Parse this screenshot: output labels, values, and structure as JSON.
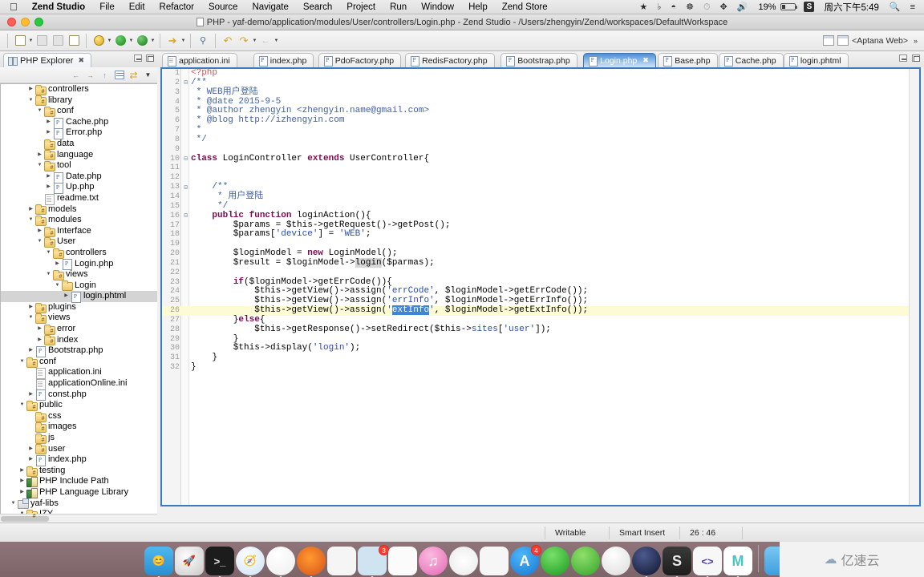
{
  "menubar": {
    "apple": "apple-logo",
    "items": [
      "Zend Studio",
      "File",
      "Edit",
      "Refactor",
      "Source",
      "Navigate",
      "Search",
      "Project",
      "Run",
      "Window",
      "Help",
      "Zend Store"
    ],
    "status_icons": [
      "dropbox-icon",
      "sound-icon",
      "wifi-icon",
      "accessibility-icon",
      "timemachine-icon",
      "bluetooth-icon",
      "volume-icon"
    ],
    "battery_percent": "19%",
    "input_method": "S",
    "clock": "周六下午5:49",
    "spotlight": "search-icon",
    "notification": "notification-center-icon"
  },
  "window": {
    "title": "PHP - yaf-demo/application/modules/User/controllers/Login.php - Zend Studio - /Users/zhengyin/Zend/workspaces/DefaultWorkspace"
  },
  "toolbar": {
    "perspective_label": "<Aptana Web>",
    "buttons": [
      "new-wizard",
      "save",
      "save-all",
      "print",
      "debug",
      "run",
      "run-coverage",
      "external-tools",
      "search",
      "undo",
      "redo",
      "back",
      "forward"
    ]
  },
  "left_panel": {
    "view_title": "PHP Explorer",
    "toolbar_buttons": [
      "back",
      "forward",
      "up",
      "collapse-all",
      "link-with-editor",
      "view-menu"
    ],
    "tree": [
      {
        "depth": 3,
        "twist": "closed",
        "icon": "folder pkg",
        "label": "controllers"
      },
      {
        "depth": 3,
        "twist": "open",
        "icon": "folder pkg",
        "label": "library"
      },
      {
        "depth": 4,
        "twist": "open",
        "icon": "folder pkg",
        "label": "conf"
      },
      {
        "depth": 5,
        "twist": "closed",
        "icon": "php",
        "label": "Cache.php"
      },
      {
        "depth": 5,
        "twist": "closed",
        "icon": "php",
        "label": "Error.php"
      },
      {
        "depth": 4,
        "twist": "none",
        "icon": "folder pkg",
        "label": "data"
      },
      {
        "depth": 4,
        "twist": "closed",
        "icon": "folder pkg",
        "label": "language"
      },
      {
        "depth": 4,
        "twist": "open",
        "icon": "folder pkg",
        "label": "tool"
      },
      {
        "depth": 5,
        "twist": "closed",
        "icon": "php",
        "label": "Date.php"
      },
      {
        "depth": 5,
        "twist": "closed",
        "icon": "php",
        "label": "Up.php"
      },
      {
        "depth": 4,
        "twist": "none",
        "icon": "txt",
        "label": "readme.txt"
      },
      {
        "depth": 3,
        "twist": "closed",
        "icon": "folder pkg",
        "label": "models"
      },
      {
        "depth": 3,
        "twist": "open",
        "icon": "folder pkg",
        "label": "modules"
      },
      {
        "depth": 4,
        "twist": "closed",
        "icon": "folder pkg",
        "label": "Interface"
      },
      {
        "depth": 4,
        "twist": "open",
        "icon": "folder pkg",
        "label": "User"
      },
      {
        "depth": 5,
        "twist": "open",
        "icon": "folder pkg",
        "label": "controllers"
      },
      {
        "depth": 6,
        "twist": "closed",
        "icon": "php",
        "label": "Login.php"
      },
      {
        "depth": 5,
        "twist": "open",
        "icon": "folder pkg",
        "label": "views"
      },
      {
        "depth": 6,
        "twist": "open",
        "icon": "folder",
        "label": "Login"
      },
      {
        "depth": 7,
        "twist": "closed",
        "icon": "php",
        "label": "login.phtml",
        "selected": true
      },
      {
        "depth": 3,
        "twist": "closed",
        "icon": "folder pkg",
        "label": "plugins"
      },
      {
        "depth": 3,
        "twist": "open",
        "icon": "folder pkg",
        "label": "views"
      },
      {
        "depth": 4,
        "twist": "closed",
        "icon": "folder pkg",
        "label": "error"
      },
      {
        "depth": 4,
        "twist": "closed",
        "icon": "folder pkg",
        "label": "index"
      },
      {
        "depth": 3,
        "twist": "closed",
        "icon": "php",
        "label": "Bootstrap.php"
      },
      {
        "depth": 2,
        "twist": "open",
        "icon": "folder pkg",
        "label": "conf"
      },
      {
        "depth": 3,
        "twist": "none",
        "icon": "txt",
        "label": "application.ini"
      },
      {
        "depth": 3,
        "twist": "none",
        "icon": "txt",
        "label": "applicationOnline.ini"
      },
      {
        "depth": 3,
        "twist": "closed",
        "icon": "php",
        "label": "const.php"
      },
      {
        "depth": 2,
        "twist": "open",
        "icon": "folder pkg",
        "label": "public"
      },
      {
        "depth": 3,
        "twist": "none",
        "icon": "folder pkg",
        "label": "css"
      },
      {
        "depth": 3,
        "twist": "none",
        "icon": "folder pkg",
        "label": "images"
      },
      {
        "depth": 3,
        "twist": "none",
        "icon": "folder pkg",
        "label": "js"
      },
      {
        "depth": 3,
        "twist": "closed",
        "icon": "folder pkg",
        "label": "user"
      },
      {
        "depth": 3,
        "twist": "closed",
        "icon": "php",
        "label": "index.php"
      },
      {
        "depth": 2,
        "twist": "closed",
        "icon": "folder pkg",
        "label": "testing"
      },
      {
        "depth": 2,
        "twist": "closed",
        "icon": "lib",
        "label": "PHP Include Path"
      },
      {
        "depth": 2,
        "twist": "closed",
        "icon": "lib",
        "label": "PHP Language Library"
      },
      {
        "depth": 1,
        "twist": "open",
        "icon": "proj",
        "label": "yaf-libs"
      },
      {
        "depth": 2,
        "twist": "open",
        "icon": "folder pkg",
        "label": "IZY"
      }
    ]
  },
  "editor": {
    "tabs": [
      {
        "label": "application.ini",
        "icon": "ini",
        "active": false
      },
      {
        "label": "index.php",
        "icon": "php",
        "active": false
      },
      {
        "label": "PdoFactory.php",
        "icon": "php",
        "active": false
      },
      {
        "label": "RedisFactory.php",
        "icon": "php",
        "active": false
      },
      {
        "label": "Bootstrap.php",
        "icon": "php",
        "active": false
      },
      {
        "label": "Login.php",
        "icon": "php",
        "active": true
      },
      {
        "label": "Base.php",
        "icon": "php",
        "active": false
      },
      {
        "label": "Cache.php",
        "icon": "php",
        "active": false
      },
      {
        "label": "login.phtml",
        "icon": "php",
        "active": false
      }
    ],
    "lines": [
      {
        "n": 1,
        "fold": "",
        "html": "<span class=\"phptag\">&lt;?php</span>"
      },
      {
        "n": 2,
        "fold": "-",
        "html": "<span class=\"cm\">/**</span>"
      },
      {
        "n": 3,
        "fold": "",
        "html": "<span class=\"cm\"> * WEB用户登陆</span>"
      },
      {
        "n": 4,
        "fold": "",
        "html": "<span class=\"cm\"> * @date 2015-9-5</span>"
      },
      {
        "n": 5,
        "fold": "",
        "html": "<span class=\"cm\"> * @author zhengyin &lt;zhengyin.name@gmail.com&gt;</span>"
      },
      {
        "n": 6,
        "fold": "",
        "html": "<span class=\"cm\"> * @blog http://izhengyin.com</span>"
      },
      {
        "n": 7,
        "fold": "",
        "html": "<span class=\"cm\"> *</span>"
      },
      {
        "n": 8,
        "fold": "",
        "html": "<span class=\"cm\"> */</span>"
      },
      {
        "n": 9,
        "fold": "",
        "html": ""
      },
      {
        "n": 10,
        "fold": "-",
        "html": "<span class=\"kw\">class</span> LoginController <span class=\"kw\">extends</span> UserController{"
      },
      {
        "n": 11,
        "fold": "",
        "html": ""
      },
      {
        "n": 12,
        "fold": "",
        "html": ""
      },
      {
        "n": 13,
        "fold": "-",
        "html": "    <span class=\"cm\">/**</span>"
      },
      {
        "n": 14,
        "fold": "",
        "html": "     <span class=\"cm\">* 用户登陆</span>"
      },
      {
        "n": 15,
        "fold": "",
        "html": "     <span class=\"cm\">*/</span>"
      },
      {
        "n": 16,
        "fold": "-",
        "html": "    <span class=\"kw\">public function</span> loginAction(){"
      },
      {
        "n": 17,
        "fold": "",
        "html": "        $params = $this-&gt;getRequest()-&gt;getPost();"
      },
      {
        "n": 18,
        "fold": "",
        "html": "        $params[<span class=\"str\">'device'</span>] = <span class=\"str\">'WEB'</span>;"
      },
      {
        "n": 19,
        "fold": "",
        "html": ""
      },
      {
        "n": 20,
        "fold": "",
        "html": "        $loginModel = <span class=\"kw\">new</span> LoginModel();"
      },
      {
        "n": 21,
        "fold": "",
        "html": "        $result = $loginModel-&gt;<span class=\"hl\">login</span>($parmas);"
      },
      {
        "n": 22,
        "fold": "",
        "html": ""
      },
      {
        "n": 23,
        "fold": "",
        "html": "        <span class=\"kw\">if</span>($loginModel-&gt;getErrCode()){"
      },
      {
        "n": 24,
        "fold": "",
        "html": "            $this-&gt;getView()-&gt;assign(<span class=\"str\">'errCode'</span>, $loginModel-&gt;getErrCode());"
      },
      {
        "n": 25,
        "fold": "",
        "html": "            $this-&gt;getView()-&gt;assign(<span class=\"str\">'errInfo'</span>, $loginModel-&gt;getErrInfo());"
      },
      {
        "n": 26,
        "fold": "",
        "cur": true,
        "html": "            $this-&gt;getView()-&gt;assign(<span class=\"str\">'</span><span class=\"selblue\">extInfo</span><span class=\"str\">'</span>, $loginModel-&gt;getExtInfo());"
      },
      {
        "n": 27,
        "fold": "",
        "html": "        }<span class=\"kw\">else</span>{"
      },
      {
        "n": 28,
        "fold": "",
        "html": "            $this-&gt;getResponse()-&gt;setRedirect($this-&gt;<span class=\"str\">sites</span>[<span class=\"str\">'user'</span>]);"
      },
      {
        "n": 29,
        "fold": "",
        "html": "        }"
      },
      {
        "n": 30,
        "fold": "",
        "html": "        $this-&gt;display(<span class=\"str\">'login'</span>);"
      },
      {
        "n": 31,
        "fold": "",
        "html": "    }"
      },
      {
        "n": 32,
        "fold": "",
        "html": "}"
      }
    ]
  },
  "statusbar": {
    "writable": "Writable",
    "insert_mode": "Smart Insert",
    "position": "26 : 46"
  },
  "dock": {
    "items": [
      {
        "name": "finder-icon",
        "glyph": "😊",
        "bg": "linear-gradient(to bottom,#4fb8f0,#2a8ed0)",
        "running": true
      },
      {
        "name": "launchpad-icon",
        "glyph": "🚀",
        "bg": "radial-gradient(circle at 40% 35%,#fdfdfd,#c9c9c9)",
        "running": false
      },
      {
        "name": "terminal-icon",
        "glyph": ">_",
        "bg": "#1c1c1c",
        "running": true
      },
      {
        "name": "safari-icon",
        "glyph": "🧭",
        "bg": "radial-gradient(circle at 40% 30%,#fbfdff,#cfe3f5)",
        "running": true
      },
      {
        "name": "chrome-icon",
        "glyph": "",
        "bg": "radial-gradient(circle at 40% 30%,#fff,#eee)",
        "running": true
      },
      {
        "name": "firefox-icon",
        "glyph": "",
        "bg": "radial-gradient(circle at 45% 40%,#ff9a2e,#d8501a)",
        "running": true
      },
      {
        "name": "calculator-icon",
        "glyph": "",
        "bg": "#f5f5f5",
        "running": false
      },
      {
        "name": "photos-icon",
        "glyph": "",
        "bg": "#cfe3f0",
        "running": true,
        "badge": "3"
      },
      {
        "name": "reminders-icon",
        "glyph": "",
        "bg": "#fbfbfb",
        "running": false
      },
      {
        "name": "itunes-icon",
        "glyph": "♫",
        "bg": "radial-gradient(circle at 40% 30%,#fbb9e0,#e46ab4)",
        "running": false
      },
      {
        "name": "photos-app-icon",
        "glyph": "",
        "bg": "radial-gradient(circle at 50% 50%,#fff,#e9e9e9)",
        "running": false
      },
      {
        "name": "pages-icon",
        "glyph": "",
        "bg": "#f6f6f6",
        "running": false
      },
      {
        "name": "appstore-icon",
        "glyph": "A",
        "bg": "radial-gradient(circle at 40% 30%,#4fb6f7,#1878d4)",
        "running": false,
        "badge": "4"
      },
      {
        "name": "thunder-icon",
        "glyph": "",
        "bg": "radial-gradient(circle at 40% 30%,#79e06a,#1a9a20)",
        "running": false
      },
      {
        "name": "wechat-icon",
        "glyph": "",
        "bg": "radial-gradient(circle at 40% 30%,#8fe06a,#35a32a)",
        "running": false
      },
      {
        "name": "qq-icon",
        "glyph": "",
        "bg": "radial-gradient(circle at 40% 30%,#fefefe,#dcdcdc)",
        "running": false
      },
      {
        "name": "quicktime-icon",
        "glyph": "",
        "bg": "radial-gradient(circle at 40% 30%,#4b5a8f,#10142c)",
        "running": true
      },
      {
        "name": "sublime-icon",
        "glyph": "S",
        "bg": "linear-gradient(to bottom,#3a3a3a,#1d1d1d)",
        "running": true
      },
      {
        "name": "vscode-icon",
        "glyph": "<>",
        "bg": "#f7f7f7",
        "running": true
      },
      {
        "name": "mweb-icon",
        "glyph": "M",
        "bg": "#ffffff",
        "running": true
      },
      {
        "name": "downloads-icon",
        "glyph": "",
        "bg": "linear-gradient(to bottom,#79c8f2,#3f9ddd)",
        "running": false
      },
      {
        "name": "trash-icon",
        "glyph": "",
        "bg": "linear-gradient(to bottom,#f2f2f2,#d6d6d6)",
        "running": false
      }
    ]
  },
  "watermark": {
    "text": "亿速云",
    "logo": "cloud-logo"
  }
}
